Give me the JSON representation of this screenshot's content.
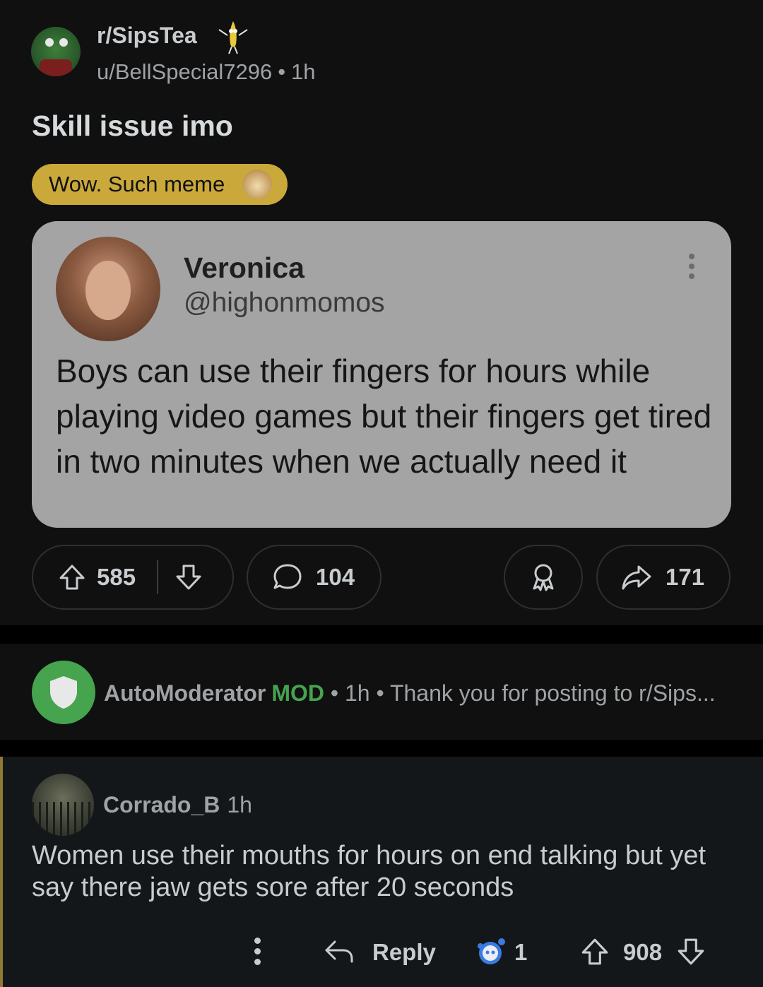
{
  "post": {
    "subreddit": "r/SipsTea",
    "author": "u/BellSpecial7296",
    "separator": "•",
    "time": "1h",
    "title": "Skill issue imo",
    "flair": "Wow. Such meme",
    "tweet": {
      "name": "Veronica",
      "handle": "@highonmomos",
      "text": "Boys can use their fingers for hours while playing video games but their fingers get tired in two minutes when we actually need it"
    },
    "actions": {
      "upvotes": "585",
      "comments": "104",
      "shares": "171"
    }
  },
  "automod": {
    "name": "AutoModerator",
    "badge": "MOD",
    "time": "1h",
    "separator": "•",
    "preview": "Thank you for posting to r/Sips..."
  },
  "comment": {
    "author": "Corrado_B",
    "time": "1h",
    "text": "Women use their mouths for hours on end talking but yet say there jaw gets sore after 20 seconds",
    "reply_label": "Reply",
    "award_count": "1",
    "score": "908"
  },
  "colors": {
    "flair_bg": "#caa93a",
    "mod_green": "#46a34e",
    "card_bg": "#a4a4a4",
    "comment_thread_bar": "#8f7a32"
  },
  "icons": {
    "upvote": "arrow-up-icon",
    "downvote": "arrow-down-icon",
    "comment": "speech-bubble-icon",
    "award": "award-ribbon-icon",
    "share": "share-arrow-icon",
    "more": "vertical-dots-icon",
    "reply": "reply-arrow-icon"
  }
}
